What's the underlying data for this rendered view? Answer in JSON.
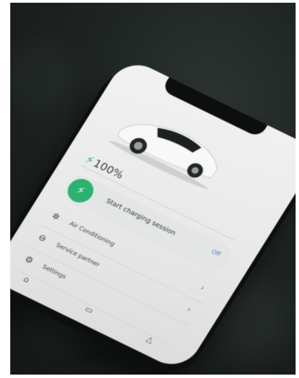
{
  "battery": {
    "percent": "100%"
  },
  "charging": {
    "label": "Start charging session",
    "state": "Off"
  },
  "menu": {
    "items": [
      {
        "label": "Air Conditioning",
        "icon": "fan-icon"
      },
      {
        "label": "Service partner",
        "icon": "service-icon"
      },
      {
        "label": "Settings",
        "icon": "gear-icon"
      }
    ]
  },
  "colors": {
    "accent": "#2bb26f",
    "link": "#4a7fd0"
  }
}
